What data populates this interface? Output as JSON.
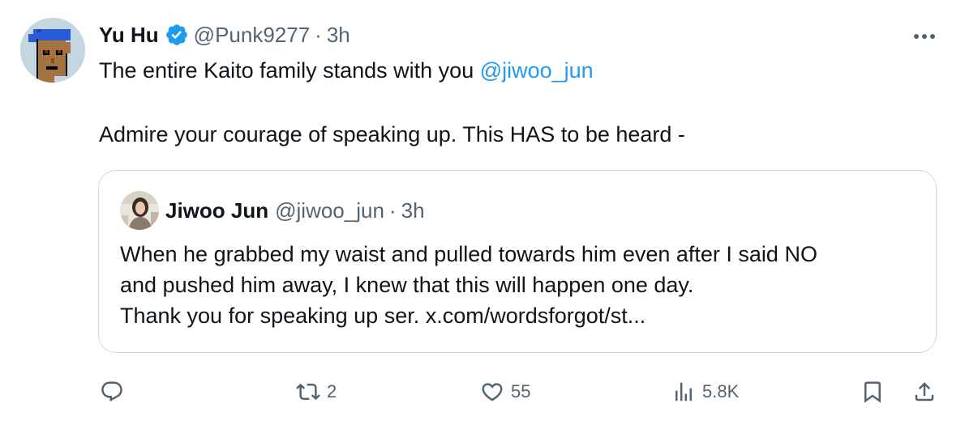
{
  "tweet": {
    "author_name": "Yu Hu",
    "author_handle": "@Punk9277",
    "separator": "·",
    "time": "3h",
    "text_line1_prefix": "The entire Kaito family stands with you ",
    "text_line1_mention": "@jiwoo_jun",
    "text_line2": "Admire your courage of speaking up. This HAS to be heard -"
  },
  "quote": {
    "author_name": "Jiwoo Jun",
    "author_handle": "@jiwoo_jun",
    "separator": "·",
    "time": "3h",
    "lines": [
      "When he grabbed my waist and pulled towards him even after I said NO",
      "and pushed him away, I knew that this will happen one day.",
      "Thank you for speaking up ser. x.com/wordsforgot/st..."
    ]
  },
  "actions": {
    "reply_icon": "reply-icon",
    "retweet_icon": "retweet-icon",
    "retweet_count": "2",
    "like_icon": "heart-icon",
    "like_count": "55",
    "views_icon": "views-icon",
    "views_count": "5.8K",
    "bookmark_icon": "bookmark-icon",
    "share_icon": "share-icon"
  },
  "colors": {
    "text": "#0f1419",
    "secondary": "#536471",
    "accent": "#1d9bf0",
    "border": "#cfd9de"
  }
}
